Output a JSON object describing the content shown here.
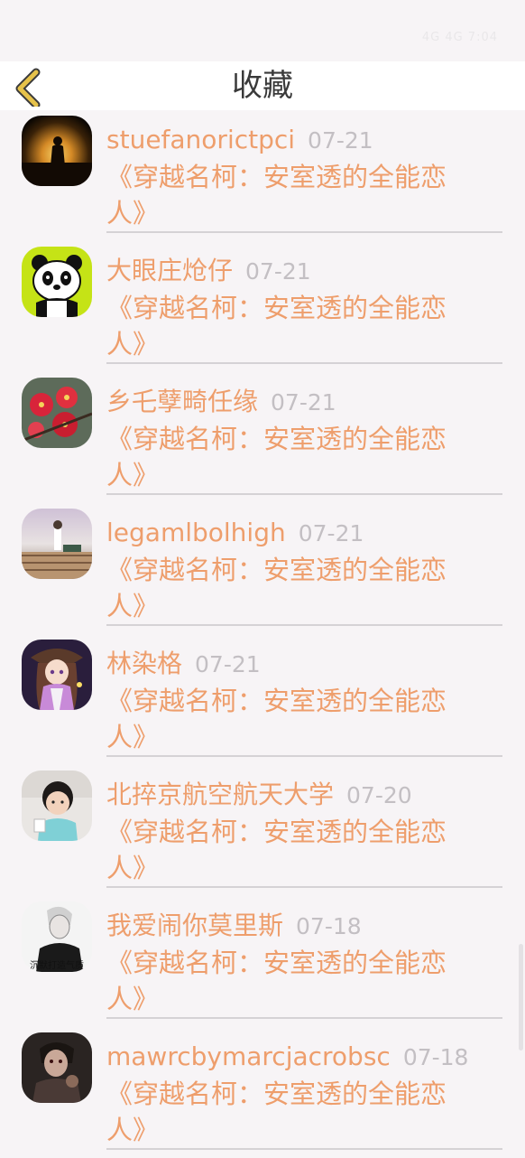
{
  "status_bar": {
    "text": "4G 4G 7:04"
  },
  "header": {
    "title": "收藏"
  },
  "items": [
    {
      "name": "stuefanorictpci",
      "date": "07-21",
      "post": "《穿越名柯：安室透的全能恋人》"
    },
    {
      "name": "大眼庄炝仔",
      "date": "07-21",
      "post": "《穿越名柯：安室透的全能恋人》"
    },
    {
      "name": "乡乇孽畸任缘",
      "date": "07-21",
      "post": "《穿越名柯：安室透的全能恋人》"
    },
    {
      "name": "legamlbolhigh",
      "date": "07-21",
      "post": "《穿越名柯：安室透的全能恋人》"
    },
    {
      "name": "林染格",
      "date": "07-21",
      "post": "《穿越名柯：安室透的全能恋人》"
    },
    {
      "name": "北捽京航空航天大学",
      "date": "07-20",
      "post": "《穿越名柯：安室透的全能恋人》"
    },
    {
      "name": "我爱闹你莫里斯",
      "date": "07-18",
      "post": "《穿越名柯：安室透的全能恋人》"
    },
    {
      "name": "mawrcbymarcjacrobsc",
      "date": "07-18",
      "post": "《穿越名柯：安室透的全能恋人》"
    }
  ],
  "avatar_captions": {
    "item_7": "沉默打造气质"
  },
  "colors": {
    "accent": "#ee9e6c",
    "date": "#c3bfc3",
    "back_arrow": "#e6c24a"
  }
}
